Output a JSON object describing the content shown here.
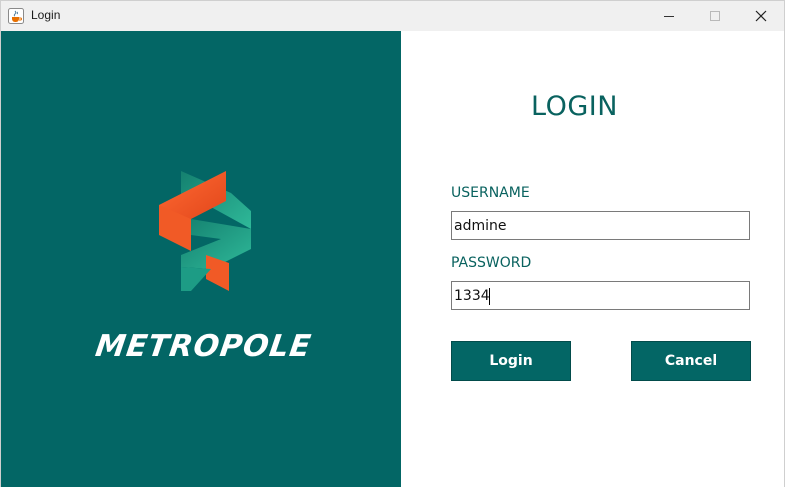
{
  "window": {
    "title": "Login",
    "icons": {
      "app": "java-cup-icon",
      "minimize": "minimize-icon",
      "maximize": "maximize-icon",
      "close": "close-icon"
    }
  },
  "brand": {
    "name": "METROPOLE",
    "logo": "metropole-s-logo",
    "colors": {
      "panel": "#036665",
      "orange": "#f05a2a",
      "teal": "#1d9c85"
    }
  },
  "form": {
    "heading": "LOGIN",
    "username_label": "USERNAME",
    "username_value": "admine",
    "password_label": "PASSWORD",
    "password_value": "1334",
    "accent_color": "#09625f"
  },
  "buttons": {
    "login_label": "Login",
    "cancel_label": "Cancel"
  }
}
